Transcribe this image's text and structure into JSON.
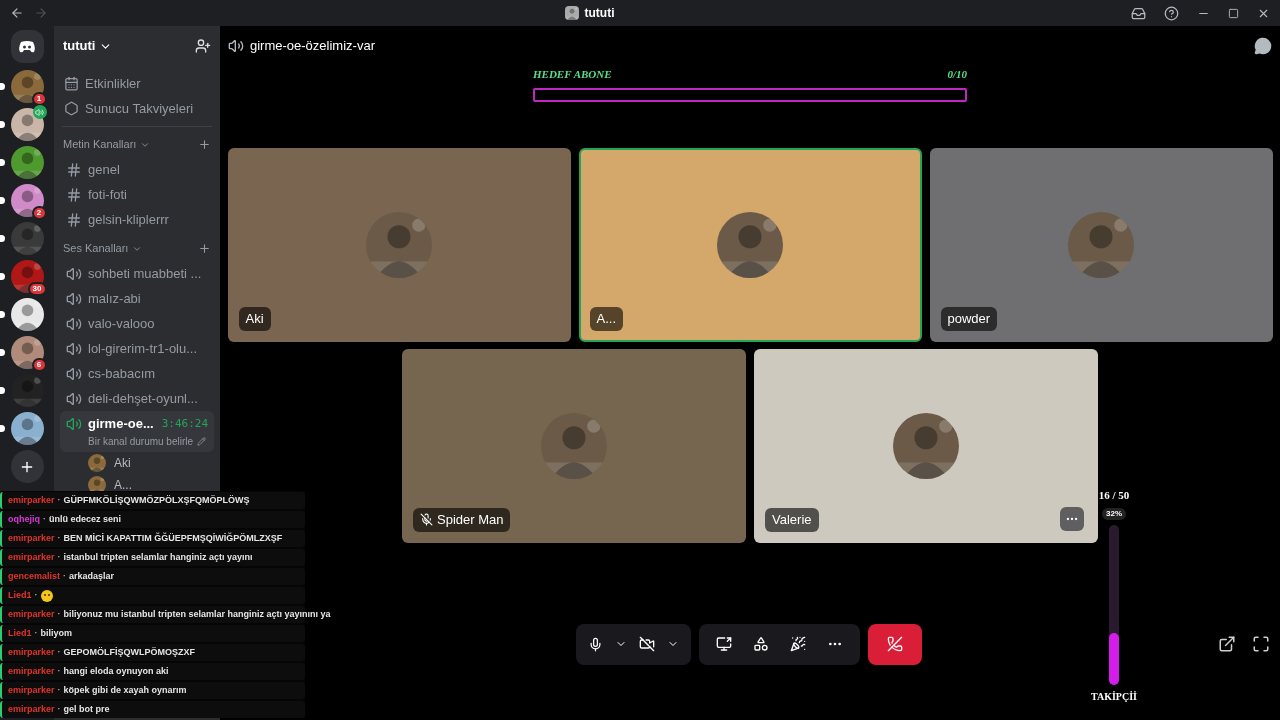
{
  "window": {
    "title": "tututi"
  },
  "servers": [
    {
      "badge": "1",
      "voice": false,
      "color": "#8a6a3a"
    },
    {
      "voice": true,
      "color": "#c9b6a8"
    },
    {
      "voice": false,
      "color": "#4e9a2e"
    },
    {
      "badge": "2",
      "voice": false,
      "color": "#d08ac8"
    },
    {
      "voice": false,
      "color": "#3a3a3a"
    },
    {
      "badge": "30",
      "voice": false,
      "color": "#b01818"
    },
    {
      "voice": false,
      "color": "#e8e8e8"
    },
    {
      "badge": "6",
      "voice": false,
      "color": "#b08a7a"
    },
    {
      "voice": false,
      "color": "#222222"
    },
    {
      "voice": false,
      "color": "#8ab0d0"
    }
  ],
  "guild": {
    "name": "tututi"
  },
  "shortcuts": [
    {
      "kind": "events",
      "label": "Etkinlikler"
    },
    {
      "kind": "boost",
      "label": "Sunucu Takviyeleri"
    }
  ],
  "categories": [
    {
      "name": "Metin Kanalları",
      "channels": [
        {
          "kind": "text",
          "name": "genel",
          "selected": false
        },
        {
          "kind": "text",
          "name": "foti-foti",
          "selected": false
        },
        {
          "kind": "text",
          "name": "gelsin-kliplerrr",
          "selected": false
        }
      ]
    },
    {
      "name": "Ses Kanalları",
      "channels": [
        {
          "kind": "voice",
          "name": "sohbeti muabbeti ...",
          "selected": false
        },
        {
          "kind": "voice",
          "name": "malız-abi",
          "selected": false
        },
        {
          "kind": "voice",
          "name": "valo-valooo",
          "selected": false
        },
        {
          "kind": "voice",
          "name": "lol-girerim-tr1-olu...",
          "selected": false
        },
        {
          "kind": "voice",
          "name": "cs-babacım",
          "selected": false
        },
        {
          "kind": "voice",
          "name": "deli-dehşet-oyunl...",
          "selected": false
        },
        {
          "kind": "voice",
          "name": "girme-oe...",
          "selected": true,
          "timer": "3:46:24",
          "status": "Bir kanal durumu belirle",
          "members": [
            "Aki",
            "A..."
          ]
        }
      ]
    }
  ],
  "channel_header": {
    "name": "girme-oe-özelimiz-var"
  },
  "goal": {
    "label": "HEDEF ABONE",
    "count": "0/10",
    "level": 0
  },
  "tiles": [
    {
      "name": "Aki",
      "speaking": false,
      "muted": false,
      "color": "#7a6550"
    },
    {
      "name": "A...",
      "speaking": true,
      "muted": false,
      "color": "#d4a76a"
    },
    {
      "name": "powder",
      "speaking": false,
      "muted": false,
      "color": "#6f6f72"
    },
    {
      "name": "Spider Man",
      "speaking": false,
      "muted": true,
      "color": "#76654f"
    },
    {
      "name": "Valerie",
      "speaking": false,
      "muted": false,
      "color": "#cdc9bf",
      "more": true
    }
  ],
  "follower_goal": {
    "count": "16 / 50",
    "percent": "32%",
    "level": 0.32,
    "label": "TAKİPÇİİ"
  },
  "chat": [
    {
      "user": "emirparker",
      "sep": "·",
      "text": "GÜPFMKÖLİŞQWMÖZPÖLXŞFQMÖPLÖWŞ",
      "color": "#e0342c"
    },
    {
      "user": "oqhejiq",
      "sep": "·",
      "text": "ünlü edecez seni",
      "color": "#d63ad6"
    },
    {
      "user": "emirparker",
      "sep": "·",
      "text": "BEN MİCİ KAPATTIM ĞĞÜEPFMŞQİWİĞPÖMLZXŞF",
      "color": "#e0342c"
    },
    {
      "user": "emirparker",
      "sep": "·",
      "text": "istanbul tripten selamlar hanginiz açtı yayını",
      "color": "#e0342c"
    },
    {
      "user": "gencemalist",
      "sep": "·",
      "text": "arkadaşlar",
      "color": "#e0342c"
    },
    {
      "user": "Lied1",
      "sep": "·",
      "kind": "emoji",
      "color": "#e0342c"
    },
    {
      "user": "emirparker",
      "sep": "·",
      "text": "biliyonuz mu istanbul tripten selamlar hanginiz açtı yayınını ya",
      "color": "#e0342c"
    },
    {
      "user": "Lied1",
      "sep": "·",
      "text": "biliyom",
      "color": "#e0342c"
    },
    {
      "user": "emirparker",
      "sep": "·",
      "text": "GEPOMÖLFİŞQWLPÖMOŞZXF",
      "color": "#e0342c"
    },
    {
      "user": "emirparker",
      "sep": "·",
      "text": "hangi eloda oynuyon aki",
      "color": "#e0342c"
    },
    {
      "user": "emirparker",
      "sep": "·",
      "text": "köpek gibi de xayah oynarım",
      "color": "#e0342c"
    },
    {
      "user": "emirparker",
      "sep": "·",
      "text": "gel bot pre",
      "color": "#e0342c"
    }
  ]
}
